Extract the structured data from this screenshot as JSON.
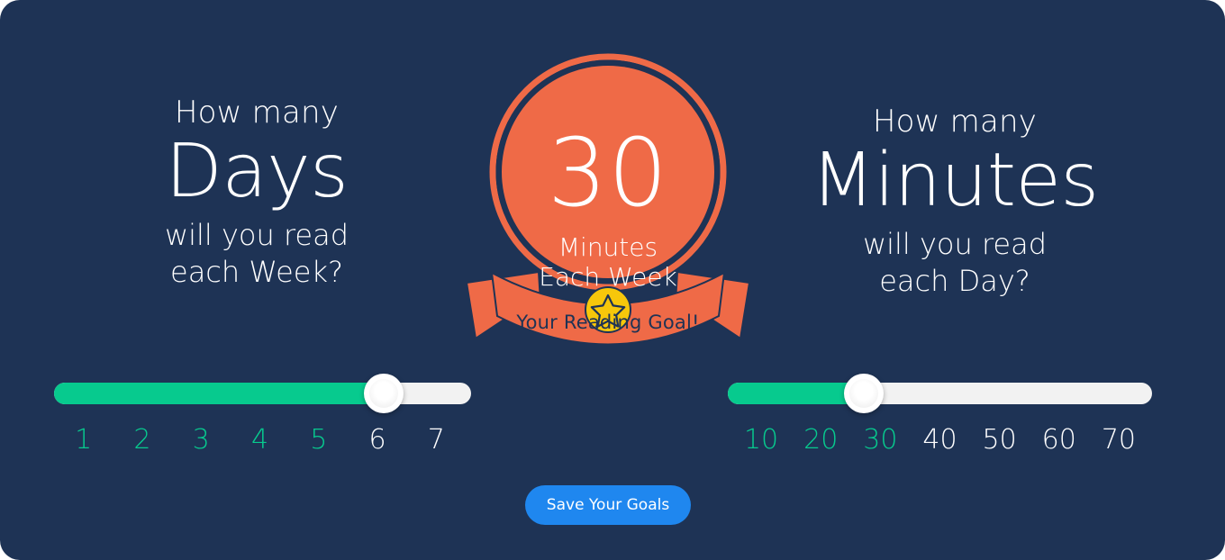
{
  "theme": {
    "background": "#1e3355",
    "accent_green": "#07ca8e",
    "accent_orange": "#ef6a47",
    "accent_blue": "#1f87ef",
    "badge_gold": "#f7c70b",
    "track_empty": "#f2f2f2",
    "text_white": "#ffffff"
  },
  "left_panel": {
    "lead": "How many",
    "highlight": "Days",
    "tail_line1": "will you read",
    "tail_line2": "each Week?"
  },
  "right_panel": {
    "lead": "How many",
    "highlight": "Minutes",
    "tail_line1": "will you read",
    "tail_line2": "each Day?"
  },
  "badge": {
    "value": "30",
    "unit_line1": "Minutes",
    "unit_line2": "Each Week",
    "ribbon_label": "Your Reading Goal!",
    "star_icon": "star-icon"
  },
  "days_slider": {
    "value": 6,
    "min": 1,
    "max": 7,
    "fill_percent": 79,
    "handle_percent": 79,
    "ticks": [
      {
        "label": "1",
        "active": true
      },
      {
        "label": "2",
        "active": true
      },
      {
        "label": "3",
        "active": true
      },
      {
        "label": "4",
        "active": true
      },
      {
        "label": "5",
        "active": true
      },
      {
        "label": "6",
        "active": false
      },
      {
        "label": "7",
        "active": false
      }
    ]
  },
  "minutes_slider": {
    "value": 30,
    "min": 10,
    "max": 70,
    "fill_percent": 32,
    "handle_percent": 32,
    "ticks": [
      {
        "label": "10",
        "active": true
      },
      {
        "label": "20",
        "active": true
      },
      {
        "label": "30",
        "active": true
      },
      {
        "label": "40",
        "active": false
      },
      {
        "label": "50",
        "active": false
      },
      {
        "label": "60",
        "active": false
      },
      {
        "label": "70",
        "active": false
      }
    ]
  },
  "actions": {
    "save_label": "Save Your Goals"
  }
}
